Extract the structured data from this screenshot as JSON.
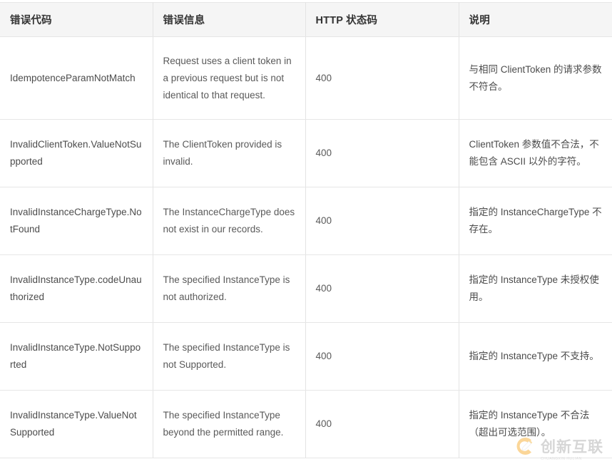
{
  "table": {
    "columns": [
      {
        "key": "code",
        "label": "错误代码"
      },
      {
        "key": "message",
        "label": "错误信息"
      },
      {
        "key": "status",
        "label": "HTTP 状态码"
      },
      {
        "key": "desc",
        "label": "说明"
      }
    ],
    "rows": [
      {
        "code": "IdempotenceParamNotMatch",
        "message": "Request uses a client token in a previous request but is not identical to that request.",
        "status": "400",
        "desc": "与相同 ClientToken 的请求参数不符合。"
      },
      {
        "code": "InvalidClientToken.ValueNotSupported",
        "message": "The ClientToken provided is invalid.",
        "status": "400",
        "desc": "ClientToken 参数值不合法，不能包含 ASCII 以外的字符。"
      },
      {
        "code": "InvalidInstanceChargeType.NotFound",
        "message": "The InstanceChargeType does not exist in our records.",
        "status": "400",
        "desc": "指定的 InstanceChargeType 不存在。"
      },
      {
        "code": "InvalidInstanceType.codeUnauthorized",
        "message": "The specified InstanceType is not authorized.",
        "status": "400",
        "desc": "指定的 InstanceType 未授权使用。"
      },
      {
        "code": "InvalidInstanceType.NotSupported",
        "message": "The specified InstanceType is not Supported.",
        "status": "400",
        "desc": "指定的 InstanceType 不支持。"
      },
      {
        "code": "InvalidInstanceType.ValueNotSupported",
        "message": "The specified InstanceType beyond the permitted range.",
        "status": "400",
        "desc": "指定的 InstanceType 不合法（超出可选范围）。"
      }
    ]
  },
  "watermark": {
    "brand": "创新互联",
    "sub": "CHUANGXIN HULIAN",
    "accent_color": "#f5a623"
  },
  "colors": {
    "header_bg": "#f5f5f5",
    "border": "#e6e6e6",
    "text": "#4c4c4c",
    "header_text": "#333333"
  }
}
